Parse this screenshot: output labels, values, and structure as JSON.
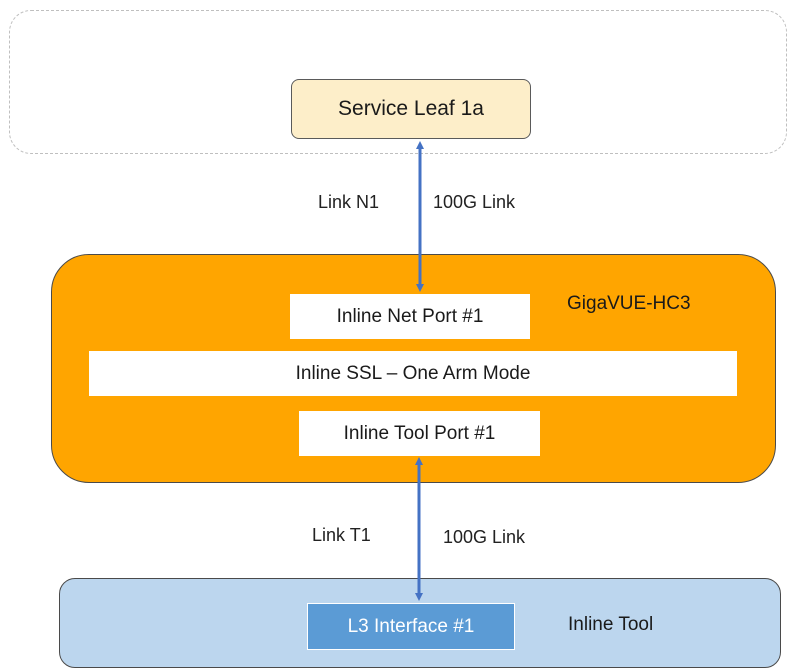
{
  "colors": {
    "service_leaf_fill": "#fdeec9",
    "gigavue_fill": "#ffa500",
    "inline_tool_fill": "#bcd6ee",
    "l3_interface_fill": "#5b9bd5",
    "link_arrow": "#4472c4",
    "dashed_border": "#bfbfbf"
  },
  "service_leaf": {
    "label": "Service Leaf 1a"
  },
  "link_n1": {
    "name": "Link N1",
    "speed": "100G Link"
  },
  "gigavue": {
    "label": "GigaVUE-HC3",
    "inline_net_port": "Inline Net Port #1",
    "inline_ssl": "Inline SSL – One Arm Mode",
    "inline_tool_port": "Inline Tool Port #1"
  },
  "link_t1": {
    "name": "Link T1",
    "speed": "100G Link"
  },
  "inline_tool": {
    "label": "Inline Tool",
    "l3_interface": "L3 Interface #1"
  }
}
